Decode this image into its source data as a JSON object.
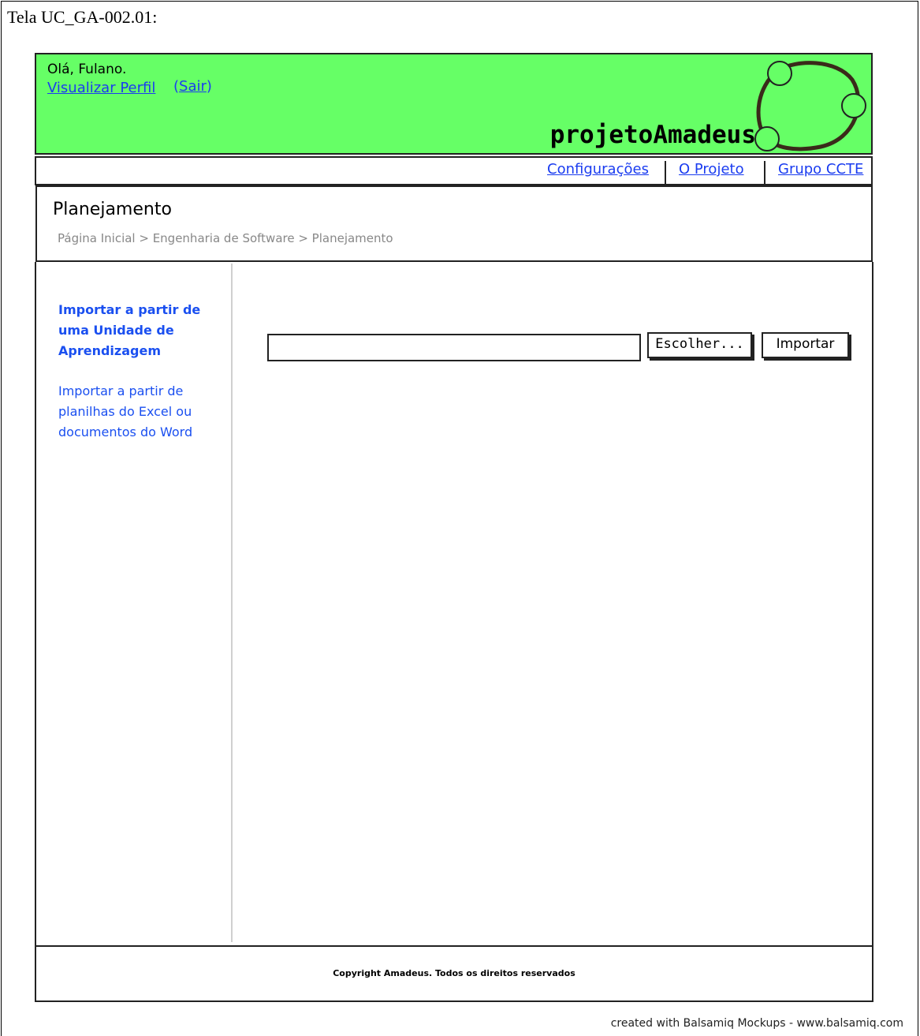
{
  "doc_title": "Tela UC_GA-002.01:",
  "header": {
    "greeting": "Olá, Fulano.",
    "profile_link": "Visualizar Perfil",
    "logout_open": "(",
    "logout_link": "Sair",
    "logout_close": ")",
    "brand": "projetoAmadeus",
    "background_color": "#66ff66"
  },
  "nav": {
    "items": [
      "Configurações",
      "O Projeto",
      "Grupo CCTE"
    ]
  },
  "page": {
    "title": "Planejamento",
    "breadcrumb": "Página Inicial > Engenharia de Software > Planejamento"
  },
  "sidebar": {
    "items": [
      {
        "label": "Importar a partir de uma Unidade de Aprendizagem"
      },
      {
        "label": "Importar a partir de planilhas do Excel ou documentos do Word"
      }
    ]
  },
  "main": {
    "file_value": "",
    "choose_button": "Escolher...",
    "import_button": "Importar"
  },
  "footer": {
    "copyright": "Copyright Amadeus. Todos os direitos reservados"
  },
  "credit": "created with Balsamiq Mockups - www.balsamiq.com",
  "colors": {
    "link": "#1a3cf0",
    "header_bg": "#66ff66"
  }
}
